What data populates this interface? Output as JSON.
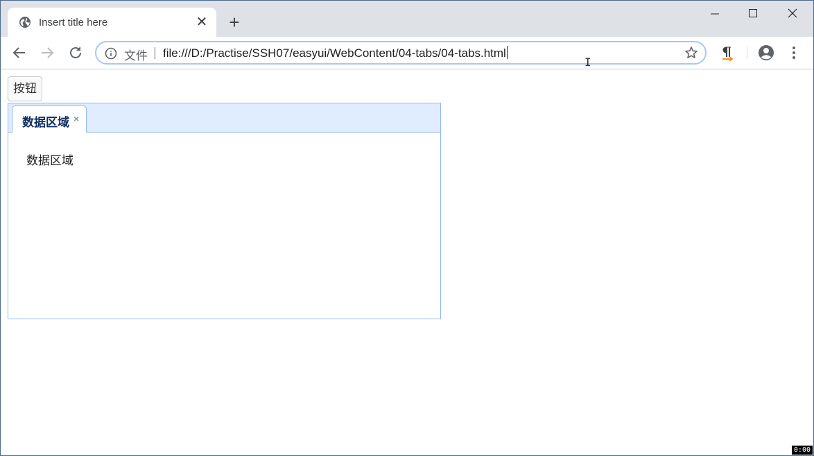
{
  "browser": {
    "tab": {
      "title": "Insert title here",
      "favicon": "globe-icon",
      "close_glyph": "✕"
    },
    "new_tab_glyph": "+",
    "window_controls": [
      "minimize-icon",
      "maximize-icon",
      "close-icon"
    ],
    "toolbar": {
      "back": "arrow-left-icon",
      "forward": "arrow-right-icon",
      "reload": "reload-icon",
      "omnibox": {
        "security_icon": "info-icon",
        "scheme_label": "文件",
        "url": "file:///D:/Practise/SSH07/easyui/WebContent/04-tabs/04-tabs.html"
      },
      "bookmark": "star-icon",
      "extension": "pilcrow-icon",
      "profile": "account-icon",
      "menu": "more-vert-icon"
    },
    "accent_color": "#a8c7fa"
  },
  "page": {
    "button_label": "按钮",
    "tabs": {
      "items": [
        {
          "title": "数据区域",
          "closable": true,
          "close_glyph": "×"
        }
      ],
      "content": "数据区域",
      "header_bg": "#e0ecff",
      "border_color": "#95b8e7"
    }
  },
  "overlay": {
    "timer": "0:00"
  }
}
